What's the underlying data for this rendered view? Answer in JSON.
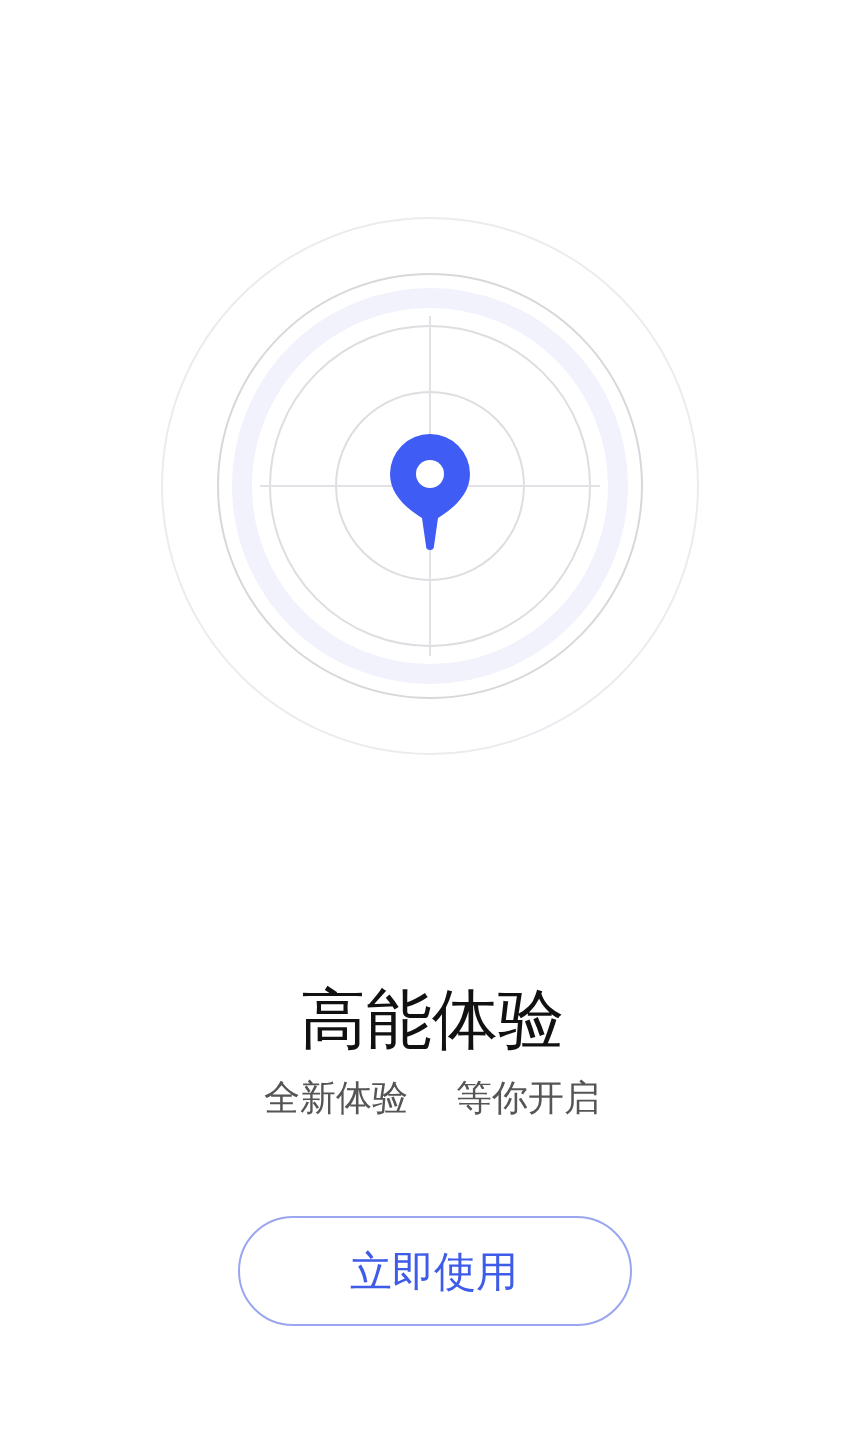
{
  "title": "高能体验",
  "subtitle": [
    "全新体验",
    "等你开启"
  ],
  "button": {
    "label": "立即使用"
  }
}
